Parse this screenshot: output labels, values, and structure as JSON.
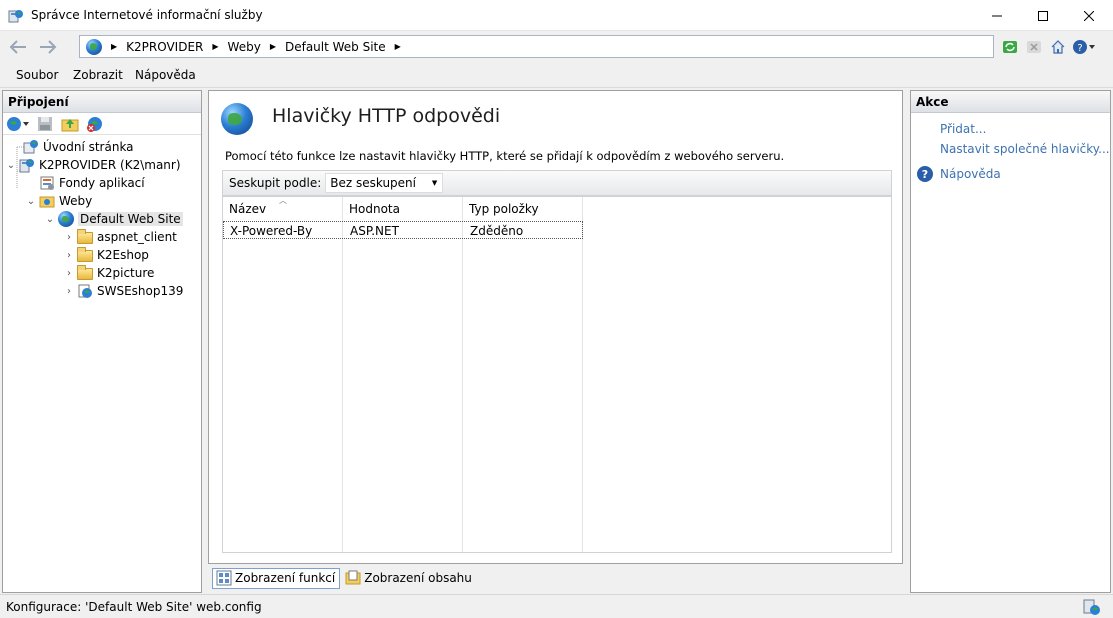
{
  "window": {
    "title": "Správce Internetové informační služby"
  },
  "address": {
    "crumbs": [
      "K2PROVIDER",
      "Weby",
      "Default Web Site"
    ]
  },
  "menu": {
    "items": [
      "Soubor",
      "Zobrazit",
      "Nápověda"
    ]
  },
  "left_panel": {
    "title": "Připojení",
    "tree": [
      {
        "label": "Úvodní stránka",
        "icon": "start-page-icon",
        "expander": ""
      },
      {
        "label": "K2PROVIDER (K2\\manr)",
        "icon": "server-icon",
        "expander": "⌄"
      },
      {
        "label": "Fondy aplikací",
        "icon": "app-pools-icon",
        "expander": ""
      },
      {
        "label": "Weby",
        "icon": "sites-folder-icon",
        "expander": "⌄"
      },
      {
        "label": "Default Web Site",
        "icon": "globe-icon",
        "expander": "⌄"
      },
      {
        "label": "aspnet_client",
        "icon": "folder-icon",
        "expander": "›"
      },
      {
        "label": "K2Eshop",
        "icon": "folder-icon",
        "expander": "›"
      },
      {
        "label": "K2picture",
        "icon": "folder-icon",
        "expander": "›"
      },
      {
        "label": "SWSEshop139",
        "icon": "web-app-icon",
        "expander": "›"
      }
    ]
  },
  "feature": {
    "title": "Hlavičky HTTP odpovědi",
    "description": "Pomocí této funkce lze nastavit hlavičky HTTP, které se přidají k odpovědím z webového serveru.",
    "group_label": "Seskupit podle:",
    "group_value": "Bez seskupení",
    "columns": [
      "Název",
      "Hodnota",
      "Typ položky"
    ],
    "rows": [
      {
        "name": "X-Powered-By",
        "value": "ASP.NET",
        "type": "Zděděno"
      }
    ]
  },
  "view_tabs": {
    "features": "Zobrazení funkcí",
    "content": "Zobrazení obsahu"
  },
  "actions": {
    "title": "Akce",
    "add": "Přidat...",
    "common_headers": "Nastavit společné hlavičky...",
    "help": "Nápověda"
  },
  "status": {
    "text": "Konfigurace: 'Default Web Site' web.config"
  },
  "colors": {
    "link": "#3e72b1",
    "selection": "#e5e5e5"
  }
}
